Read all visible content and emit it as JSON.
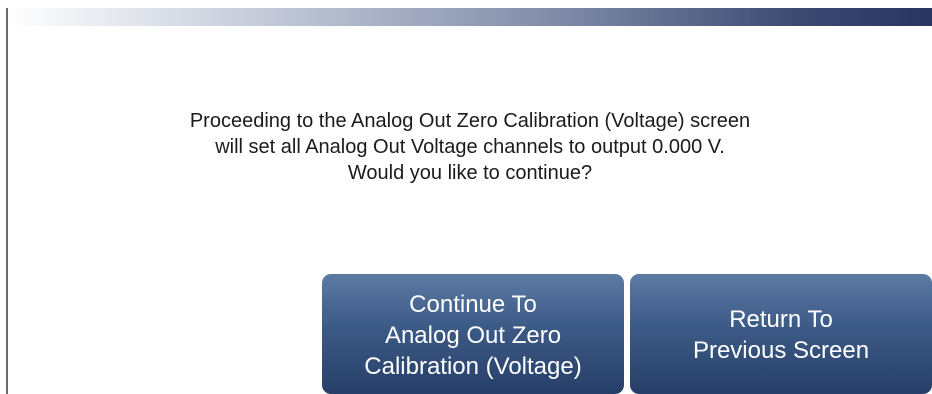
{
  "message": {
    "lines": [
      "Proceeding to the Analog Out Zero Calibration (Voltage) screen",
      "will set all Analog Out Voltage channels to output 0.000 V.",
      "Would you like to continue?"
    ]
  },
  "buttons": {
    "continue": {
      "lines": [
        "Continue To",
        "Analog Out Zero",
        "Calibration (Voltage)"
      ]
    },
    "return": {
      "lines": [
        "Return To",
        "Previous Screen"
      ]
    }
  },
  "colors": {
    "button_top": "#5b7aa4",
    "button_bottom": "#263f68",
    "title_bar_dark": "#27355f"
  }
}
